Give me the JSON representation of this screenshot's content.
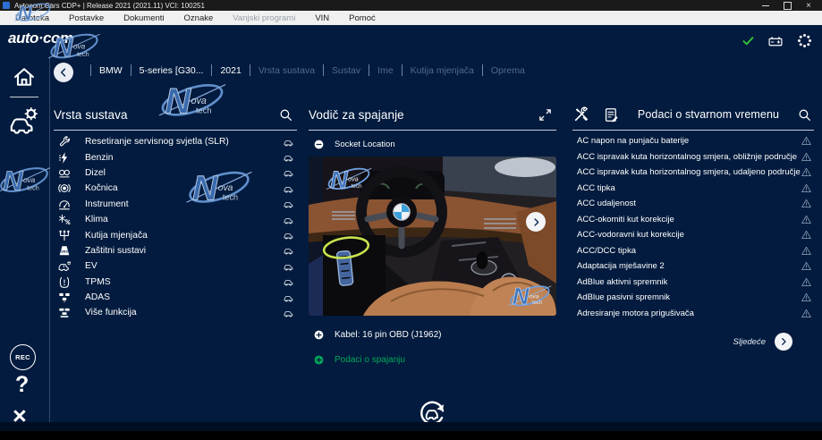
{
  "titlebar": {
    "title": "Autocom Cars CDP+  |  Release 2021 (2021.11) VCI: 100251"
  },
  "menubar": {
    "items": [
      {
        "label": "Datoteka",
        "enabled": true
      },
      {
        "label": "Postavke",
        "enabled": true
      },
      {
        "label": "Dokumenti",
        "enabled": true
      },
      {
        "label": "Oznake",
        "enabled": true
      },
      {
        "label": "Vanjski programi",
        "enabled": false
      },
      {
        "label": "VIN",
        "enabled": true
      },
      {
        "label": "Pomoć",
        "enabled": true
      }
    ]
  },
  "header": {
    "logo_text": "auto·com"
  },
  "breadcrumb": {
    "items": [
      {
        "label": "BMW",
        "active": true
      },
      {
        "label": "5-series [G30...",
        "active": true
      },
      {
        "label": "2021",
        "active": true
      },
      {
        "label": "Vrsta sustava",
        "active": false
      },
      {
        "label": "Sustav",
        "active": false
      },
      {
        "label": "Ime",
        "active": false
      },
      {
        "label": "Kutija mjenjača",
        "active": false
      },
      {
        "label": "Oprema",
        "active": false
      }
    ]
  },
  "sidebar": {
    "rec_label": "REC",
    "help_label": "?",
    "close_label": "×"
  },
  "systems_panel": {
    "title": "Vrsta sustava",
    "items": [
      {
        "icon": "wrench",
        "label": "Resetiranje servisnog svjetla (SLR)"
      },
      {
        "icon": "injector",
        "label": "Benzin"
      },
      {
        "icon": "glowplug",
        "label": "Dizel"
      },
      {
        "icon": "abs",
        "label": "Kočnica"
      },
      {
        "icon": "gauge",
        "label": "Instrument"
      },
      {
        "icon": "climate",
        "label": "Klima"
      },
      {
        "icon": "shifter",
        "label": "Kutija mjenjača"
      },
      {
        "icon": "srs",
        "label": "Zaštitni sustavi"
      },
      {
        "icon": "ev",
        "label": "EV"
      },
      {
        "icon": "tpms",
        "label": "TPMS"
      },
      {
        "icon": "adas",
        "label": "ADAS"
      },
      {
        "icon": "more",
        "label": "Više funkcija"
      }
    ]
  },
  "guide_panel": {
    "title": "Vodič za spajanje",
    "section_label": "Socket Location",
    "cable_label": "Kabel: 16 pin OBD (J1962)",
    "connection_label": "Podaci o spajanju"
  },
  "live_panel": {
    "title": "Podaci o stvarnom vremenu",
    "next_label": "Sljedeće",
    "items": [
      "AC napon na punjaču baterije",
      "ACC ispravak kuta horizontalnog smjera, obližnje područje",
      "ACC ispravak kuta horizontalnog smjera, udaljeno područje",
      "ACC tipka",
      "ACC udaljenost",
      "ACC-okomiti kut korekcije",
      "ACC-vodoravni kut korekcije",
      "ACC/DCC tipka",
      "Adaptacija mješavine 2",
      "AdBlue aktivni spremnik",
      "AdBlue pasivni spremnik",
      "Adresiranje motora prigušivača"
    ]
  },
  "icons": {
    "window": [
      "minimize-icon",
      "maximize-icon",
      "close-icon"
    ],
    "header": [
      "check-icon",
      "vci-battery-icon",
      "spinner-dots-icon"
    ],
    "panel": [
      "search-icon",
      "expand-icon",
      "minus-circle-icon",
      "plus-circle-icon",
      "tools-icon",
      "report-icon",
      "warning-triangle-icon",
      "car-icon",
      "chevron-left-icon",
      "chevron-right-icon",
      "car-swap-icon"
    ]
  },
  "colors": {
    "background": "#021b3e",
    "accent_green": "#00a85a",
    "check_green": "#35c635",
    "dim_text": "#56698d",
    "warning": "#8494ad",
    "highlight_ellipse": "#c6e24e"
  }
}
